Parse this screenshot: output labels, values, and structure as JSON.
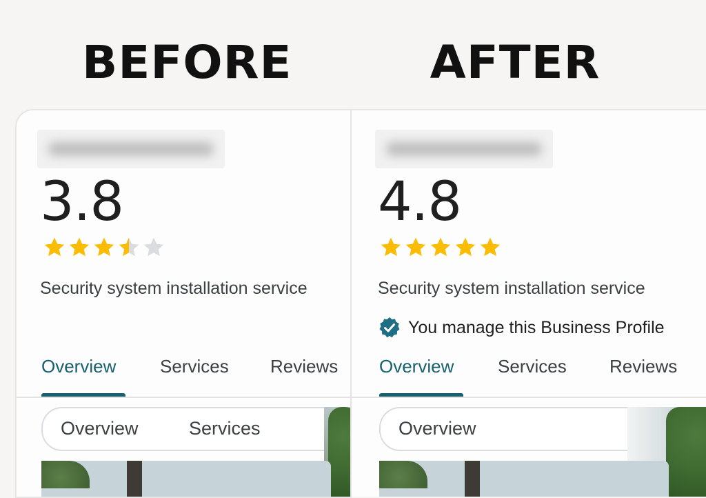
{
  "headings": {
    "before": "BEFORE",
    "after": "AFTER"
  },
  "before": {
    "rating": "3.8",
    "stars_filled": 3.5,
    "category": "Security system installation service",
    "tabs": [
      "Overview",
      "Services",
      "Reviews"
    ],
    "active_tab": "Overview",
    "chips": [
      "Overview",
      "Services"
    ]
  },
  "after": {
    "rating": "4.8",
    "stars_filled": 5,
    "category": "Security system installation service",
    "managed_text": "You manage this Business Profile",
    "managed_icon": "verified-check-icon",
    "tabs": [
      "Overview",
      "Services",
      "Reviews"
    ],
    "active_tab": "Overview",
    "chips": [
      "Overview"
    ]
  },
  "colors": {
    "star": "#fbbc04",
    "star_empty": "#dadce0",
    "accent": "#17606e",
    "badge": "#1e6f86"
  }
}
